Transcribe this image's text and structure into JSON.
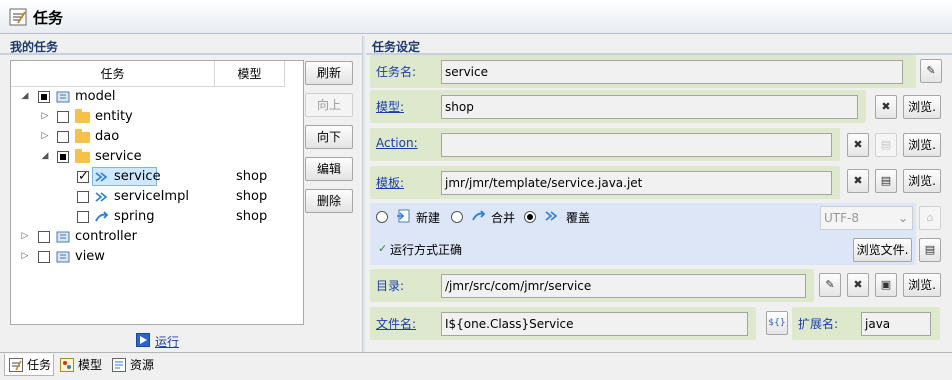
{
  "window": {
    "title": "任务"
  },
  "left": {
    "section_title": "我的任务",
    "columns": {
      "task": "任务",
      "model": "模型"
    },
    "tree": [
      {
        "label": "model",
        "model": ""
      },
      {
        "label": "entity",
        "model": ""
      },
      {
        "label": "dao",
        "model": ""
      },
      {
        "label": "service",
        "model": ""
      },
      {
        "label": "service",
        "model": "shop"
      },
      {
        "label": "serviceImpl",
        "model": "shop"
      },
      {
        "label": "spring",
        "model": "shop"
      },
      {
        "label": "controller",
        "model": ""
      },
      {
        "label": "view",
        "model": ""
      }
    ],
    "buttons": {
      "refresh": "刷新",
      "up": "向上",
      "down": "向下",
      "edit": "编辑",
      "delete": "删除"
    },
    "run_link": "运行"
  },
  "right": {
    "section_title": "任务设定",
    "task_name": {
      "label": "任务名:",
      "value": "service"
    },
    "model": {
      "label": "模型:",
      "value": "shop",
      "browse": "浏览."
    },
    "action": {
      "label": "Action:",
      "value": "",
      "browse": "浏览."
    },
    "template": {
      "label": "模板:",
      "value": "jmr/jmr/template/service.java.jet",
      "browse": "浏览."
    },
    "mode": {
      "new": "新建",
      "merge": "合并",
      "overwrite": "覆盖",
      "encoding": "UTF-8",
      "selected": "overwrite"
    },
    "status": {
      "text": "运行方式正确",
      "browse_file": "浏览文件."
    },
    "directory": {
      "label": "目录:",
      "value": "/jmr/src/com/jmr/service",
      "browse": "浏览."
    },
    "filename": {
      "label": "文件名:",
      "value": "I${one.Class}Service",
      "var_button": "${}",
      "ext_label": "扩展名:",
      "ext_value": "java"
    }
  },
  "bottom_tabs": [
    {
      "label": "任务"
    },
    {
      "label": "模型"
    },
    {
      "label": "资源"
    }
  ],
  "colors": {
    "panel": "#dde8cc",
    "link": "#1a3ea8",
    "selection": "#cde8ff"
  }
}
